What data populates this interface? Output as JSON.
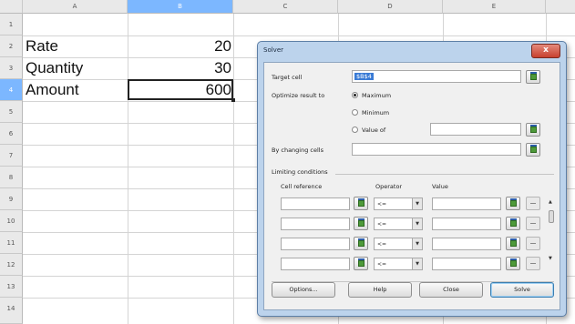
{
  "columns": [
    "A",
    "B",
    "C",
    "D",
    "E"
  ],
  "rows": [
    "1",
    "2",
    "3",
    "4",
    "5",
    "6",
    "7",
    "8",
    "9",
    "10",
    "11",
    "12",
    "13",
    "14"
  ],
  "cells": {
    "a2": "Rate",
    "b2": "20",
    "a3": "Quantity",
    "b3": "30",
    "a4": "Amount",
    "b4": "600"
  },
  "dialog": {
    "title": "Solver",
    "close_label": "x",
    "target_cell_label": "Target cell",
    "target_cell_value": "$B$4",
    "optimize_label": "Optimize result to",
    "maximum_label": "Maximum",
    "minimum_label": "Minimum",
    "value_of_label": "Value of",
    "changing_cells_label": "By changing cells",
    "limiting_label": "Limiting conditions",
    "col_cell_reference": "Cell reference",
    "col_operator": "Operator",
    "col_value": "Value",
    "operator_value": "<=",
    "buttons": {
      "options": "Options...",
      "help": "Help",
      "close": "Close",
      "solve": "Solve"
    }
  }
}
